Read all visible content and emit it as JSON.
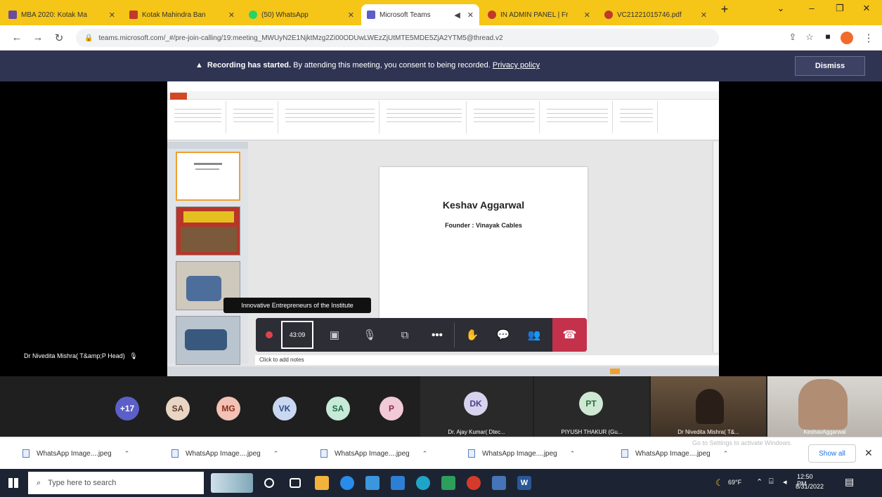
{
  "browser": {
    "tabs": [
      {
        "label": "MBA 2020: Kotak Ma",
        "fav_color": "#6a4c9c",
        "active": false
      },
      {
        "label": "Kotak Mahindra Ban",
        "fav_color": "#c0392b",
        "active": false
      },
      {
        "label": "(50) WhatsApp",
        "fav_color": "#25d366",
        "active": false
      },
      {
        "label": "Microsoft Teams",
        "fav_color": "#5b5fc7",
        "active": true
      },
      {
        "label": "IN ADMIN PANEL | Fr",
        "fav_color": "#c0392b",
        "active": false
      },
      {
        "label": "VC21221015746.pdf",
        "fav_color": "#c0392b",
        "active": false
      }
    ],
    "new_tab": "+",
    "url": "teams.microsoft.com/_#/pre-join-calling/19:meeting_MWUyN2E1NjktMzg2Zi00ODUwLWEzZjUtMTE5MDE5ZjA2YTM5@thread.v2"
  },
  "banner": {
    "bold": "Recording has started.",
    "text": " By attending this meeting, you consent to being recorded. ",
    "link": "Privacy policy",
    "dismiss": "Dismiss"
  },
  "slide": {
    "name": "Keshav Aggarwal",
    "subtitle": "Founder : Vinayak Cables"
  },
  "ppt": {
    "notes": "Click to add notes"
  },
  "call": {
    "tooltip": "Innovative Entrepreneurs of the Institute",
    "timer": "43:09",
    "presenter": "Dr Nivedita Mishra( T&amp;P Head)"
  },
  "participants": {
    "avatars": [
      {
        "label": "+17",
        "bg": "#5b5fc7",
        "fg": "#ffffff"
      },
      {
        "label": "SA",
        "bg": "#e8d5c4",
        "fg": "#5a3a2a"
      },
      {
        "label": "MG",
        "bg": "#f3c2b4",
        "fg": "#8a2d1c"
      },
      {
        "label": "VK",
        "bg": "#c9d7f0",
        "fg": "#2a4a8a"
      },
      {
        "label": "SA",
        "bg": "#c7ead8",
        "fg": "#1d6a45"
      },
      {
        "label": "P",
        "bg": "#f2c9d6",
        "fg": "#8a2d4a"
      }
    ],
    "tiles": [
      {
        "initials": "DK",
        "name": "Dr. Ajay Kumar( Dtec...",
        "bg": "#d7d3ee",
        "fg": "#4a3f8a"
      },
      {
        "initials": "PT",
        "name": "PIYUSH THAKUR (Gu...",
        "bg": "#cfe8d4",
        "fg": "#2e6b3a"
      },
      {
        "initials": "",
        "name": "Dr Nivedita Mishra( T&...",
        "bg": "",
        "fg": ""
      },
      {
        "initials": "",
        "name": "KeshavAggarwal",
        "bg": "",
        "fg": ""
      }
    ]
  },
  "downloads": {
    "items": [
      "WhatsApp Image....jpeg",
      "WhatsApp Image....jpeg",
      "WhatsApp Image....jpeg",
      "WhatsApp Image....jpeg",
      "WhatsApp Image....jpeg"
    ],
    "show_all": "Show all",
    "watermark": "Go to Settings to activate Windows."
  },
  "taskbar": {
    "search_placeholder": "Type here to search",
    "weather": "69°F",
    "time": "12:50 PM",
    "date": "8/31/2022"
  }
}
